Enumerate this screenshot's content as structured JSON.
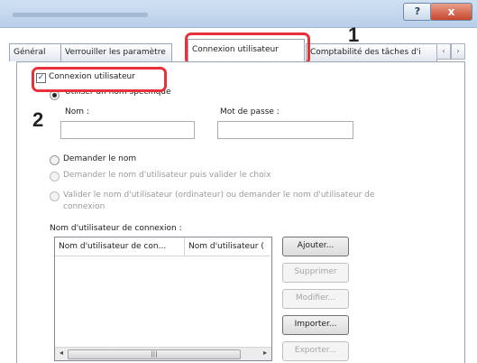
{
  "window": {
    "help_label": "?",
    "close_label": "x"
  },
  "tabs": [
    {
      "label": "Général",
      "active": false
    },
    {
      "label": "Verrouiller les paramètre",
      "active": false
    },
    {
      "label": "Connexion utilisateur",
      "active": true
    },
    {
      "label": "Comptabilité des tâches d'i",
      "active": false
    }
  ],
  "tab_nav": {
    "prev": "‹",
    "next": "›"
  },
  "callouts": {
    "one": "1",
    "two": "2"
  },
  "login_checkbox": {
    "label": "Connexion utilisateur",
    "checked": true
  },
  "specific_name": {
    "label": "Utiliser un nom spécifique",
    "selected": true
  },
  "fields": {
    "name_label": "Nom :",
    "name_value": "",
    "password_label": "Mot de passe :",
    "password_value": ""
  },
  "options": [
    {
      "label": "Demander le nom",
      "enabled": true
    },
    {
      "label": "Demander le nom d'utilisateur puis valider le choix",
      "enabled": false
    },
    {
      "label_line1": "Valider le nom d'utilisateur (ordinateur) ou demander le nom d'utilisateur de",
      "label_line2": "connexion",
      "enabled": false
    }
  ],
  "login_names": {
    "title": "Nom d'utilisateur de connexion :",
    "columns": [
      "Nom d'utilisateur de con...",
      "Nom d'utilisateur ("
    ],
    "rows": []
  },
  "scroll": {
    "left": "◂",
    "grip": "|||",
    "right": "▸"
  },
  "buttons": {
    "add": "Ajouter...",
    "delete": "Supprimer",
    "modify": "Modifier...",
    "import": "Importer...",
    "export": "Exporter..."
  },
  "colors": {
    "highlight": "#e8313b",
    "accent": "#1a4f9e"
  }
}
